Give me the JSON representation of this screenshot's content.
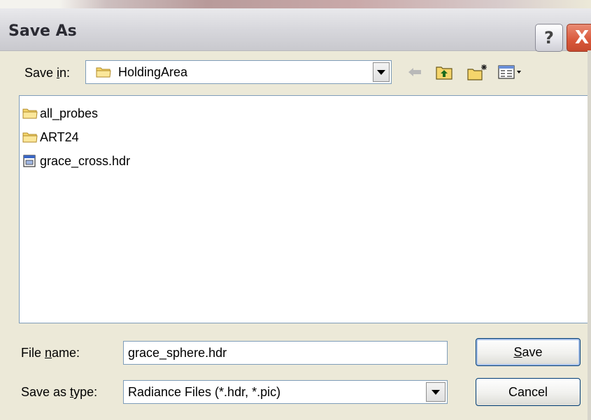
{
  "window": {
    "title": "Save As",
    "help_glyph": "?",
    "close_glyph": "X"
  },
  "save_in": {
    "label_pre": "Save ",
    "label_mnemonic": "i",
    "label_post": "n:",
    "current_folder": "HoldingArea",
    "folder_icon": "folder-icon"
  },
  "toolbar": {
    "back_icon": "back-arrow-icon",
    "up_icon": "up-one-level-icon",
    "new_folder_icon": "new-folder-icon",
    "views_icon": "views-menu-icon"
  },
  "files": [
    {
      "name": "all_probes",
      "type": "folder",
      "icon": "folder-icon"
    },
    {
      "name": "ART24",
      "type": "folder",
      "icon": "folder-icon"
    },
    {
      "name": "grace_cross.hdr",
      "type": "file",
      "icon": "file-icon"
    }
  ],
  "file_name": {
    "label_pre": "File ",
    "label_mnemonic": "n",
    "label_post": "ame:",
    "value": "grace_sphere.hdr"
  },
  "save_as_type": {
    "label_pre": "Save as ",
    "label_mnemonic": "t",
    "label_post": "ype:",
    "value": "Radiance Files (*.hdr, *.pic)"
  },
  "buttons": {
    "save_mnemonic": "S",
    "save_rest": "ave",
    "cancel": "Cancel"
  },
  "colors": {
    "dialog_bg": "#ece9d8",
    "border_blue": "#7f9db9",
    "close_red": "#d9573a",
    "folder_yellow": "#f5d56b"
  }
}
